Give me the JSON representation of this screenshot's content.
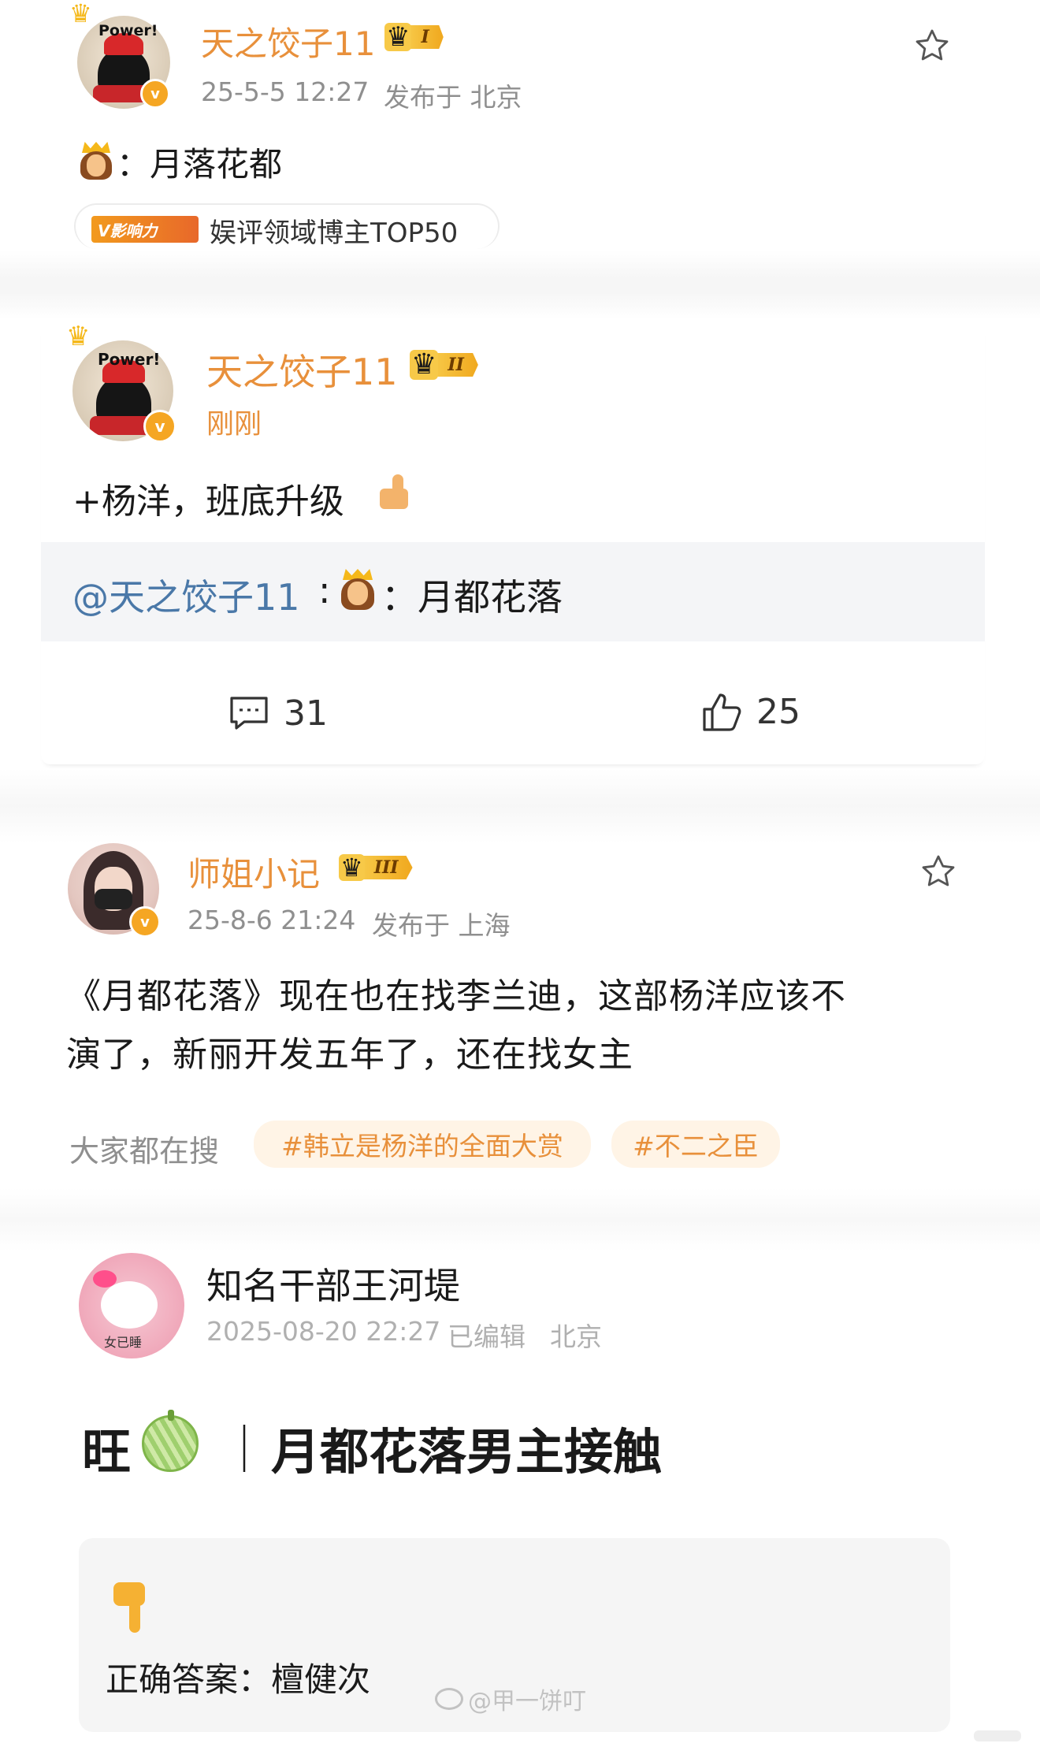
{
  "post1": {
    "username": "天之饺子11",
    "rank": "I",
    "timestamp": "25-5-5 12:27",
    "location": "发布于 北京",
    "body_text": "：月落花都",
    "influence_badge": "V影响力",
    "influence_text": "娱评领域博主TOP50"
  },
  "post2": {
    "username": "天之饺子11",
    "rank": "II",
    "timestamp": "刚刚",
    "body_text": "+杨洋，班底升级",
    "quote_mention": "@天之饺子11",
    "quote_text": "：月都花落",
    "comment_count": "31",
    "like_count": "25"
  },
  "post3": {
    "username": "师姐小记",
    "rank": "III",
    "timestamp": "25-8-6 21:24",
    "location": "发布于 上海",
    "body_line1": "《月都花落》现在也在找李兰迪，这部杨洋应该不",
    "body_line2": "演了，新丽开发五年了，还在找女主",
    "search_label": "大家都在搜",
    "hashtags": [
      "#韩立是杨洋的全面大赏",
      "#不二之臣"
    ]
  },
  "post4": {
    "username": "知名干部王河堤",
    "timestamp": "2025-08-20 22:27",
    "edited": "已编辑",
    "location": "北京",
    "headline_left": "旺",
    "headline_sep": "｜",
    "headline_right": "月都花落男主接触",
    "answer_text": "正确答案：檀健次"
  },
  "avatar_text": {
    "power": "Power!",
    "kitty": "女已睡"
  },
  "watermark": "@甲一饼叮",
  "colors": {
    "username": "#e8903b",
    "meta": "#8f8f8f",
    "badge_gold": "#f5a623"
  }
}
